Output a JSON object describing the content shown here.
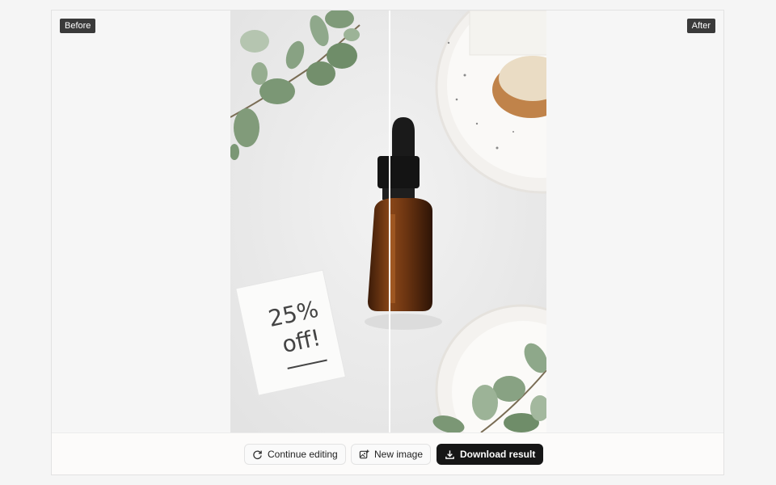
{
  "labels": {
    "before": "Before",
    "after": "After"
  },
  "note": {
    "line1": "25%",
    "line2": "off!"
  },
  "actions": {
    "continue": "Continue editing",
    "new_image": "New image",
    "download": "Download result"
  },
  "icons": {
    "continue": "refresh-icon",
    "new_image": "image-plus-icon",
    "download": "download-icon"
  },
  "colors": {
    "primary_button": "#161616",
    "badge": "#3a3a3a"
  }
}
